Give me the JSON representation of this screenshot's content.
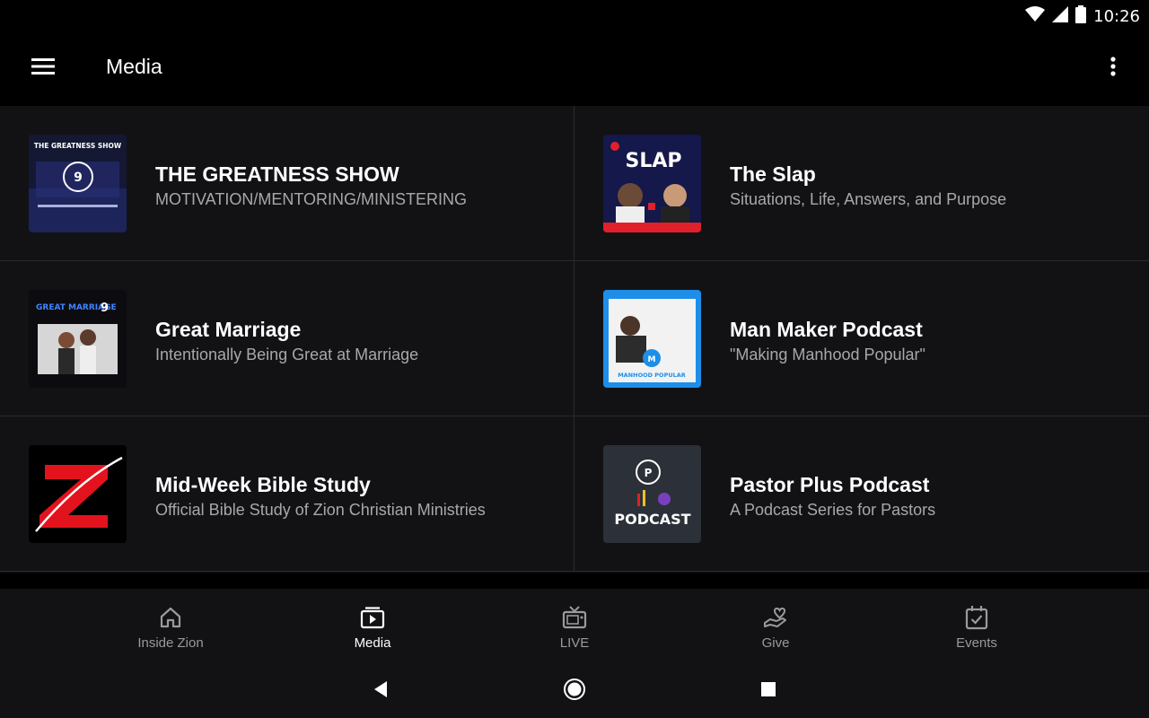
{
  "status_bar": {
    "time": "10:26",
    "icons": [
      "wifi-icon",
      "signal-icon",
      "battery-icon"
    ]
  },
  "app_bar": {
    "title": "Media",
    "menu_icon": "hamburger-menu-icon",
    "overflow_icon": "more-vert-icon"
  },
  "media_items": [
    {
      "title": "THE GREATNESS SHOW",
      "subtitle": "MOTIVATION/MENTORING/MINISTERING",
      "thumb_text": "THE GREATNESS SHOW"
    },
    {
      "title": "The Slap",
      "subtitle": "Situations, Life, Answers, and Purpose",
      "thumb_text": "SLAP"
    },
    {
      "title": "Great Marriage",
      "subtitle": "Intentionally Being Great at Marriage",
      "thumb_text": "GREAT MARRIAGE"
    },
    {
      "title": "Man Maker Podcast",
      "subtitle": "\"Making Manhood Popular\"",
      "thumb_text": "MANHOOD POPULAR"
    },
    {
      "title": "Mid-Week Bible Study",
      "subtitle": "Official Bible Study of Zion Christian Ministries",
      "thumb_text": "Z"
    },
    {
      "title": "Pastor Plus Podcast",
      "subtitle": "A Podcast Series for Pastors",
      "thumb_text": "PODCAST"
    }
  ],
  "bottom_nav": [
    {
      "label": "Inside Zion",
      "icon": "home-icon",
      "active": false
    },
    {
      "label": "Media",
      "icon": "media-icon",
      "active": true
    },
    {
      "label": "LIVE",
      "icon": "tv-icon",
      "active": false
    },
    {
      "label": "Give",
      "icon": "give-heart-icon",
      "active": false
    },
    {
      "label": "Events",
      "icon": "calendar-check-icon",
      "active": false
    }
  ],
  "colors": {
    "background": "#121215",
    "app_bar": "#000000",
    "primary_text": "#ffffff",
    "secondary_text": "#a8a8ab",
    "divider": "#2a2a2e"
  }
}
